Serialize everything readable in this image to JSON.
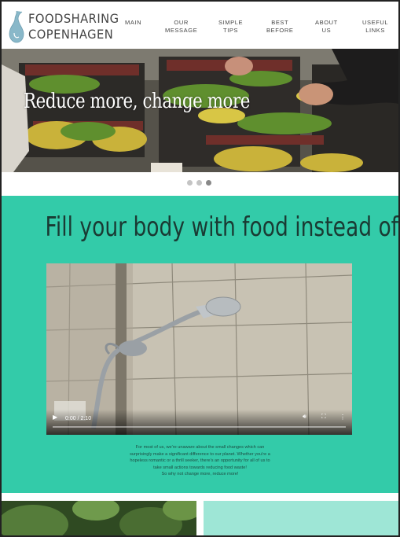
{
  "brand": {
    "line1": "FOODSHARING",
    "line2": "COPENHAGEN"
  },
  "nav": [
    {
      "line1": "MAIN",
      "line2": ""
    },
    {
      "line1": "OUR",
      "line2": "MESSAGE"
    },
    {
      "line1": "SIMPLE",
      "line2": "TIPS"
    },
    {
      "line1": "BEST",
      "line2": "BEFORE"
    },
    {
      "line1": "ABOUT",
      "line2": "US"
    },
    {
      "line1": "USEFUL",
      "line2": "LINKS"
    }
  ],
  "hero": {
    "title": "Reduce more, change more",
    "slides": 3,
    "active_slide": 3
  },
  "section": {
    "title": "Fill your body with food instead of regret",
    "video": {
      "time": "0:00 / 2:10",
      "progress": 0
    },
    "description": [
      "For most of us, we're unaware about the small changes which can",
      "surprisingly make a significant difference to our planet. Whether you're a",
      "hopeless romantic or a thrill seeker, there's an opportunity for all of us to",
      "take small actions towards reducing food waste!",
      "So why not change more, reduce more!"
    ]
  },
  "colors": {
    "teal": "#33cba9",
    "light_teal": "#9ee6d6",
    "text_dark": "#444444"
  }
}
